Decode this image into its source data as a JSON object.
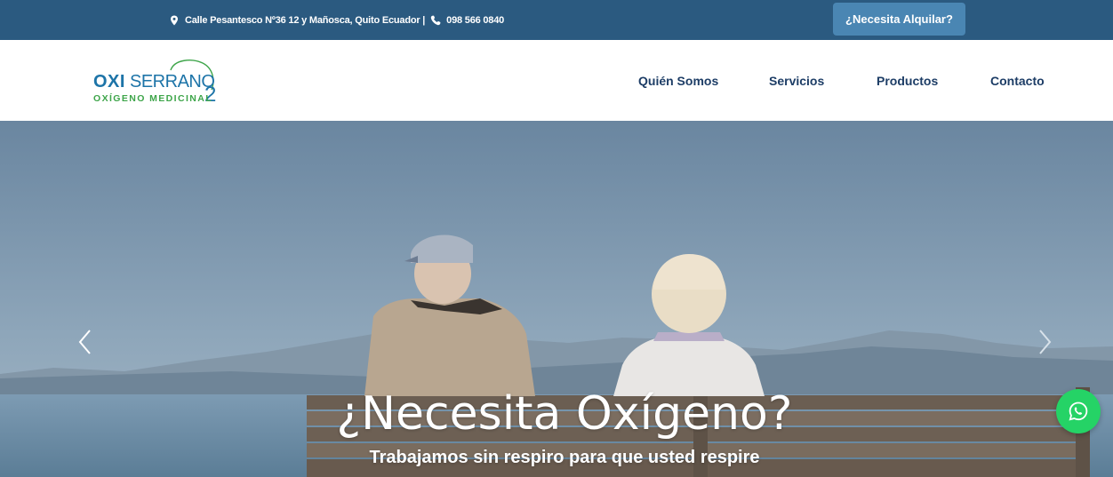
{
  "topbar": {
    "address": "Calle Pesantesco Nº36 12 y Mañosca, Quito   Ecuador |",
    "phone": "098 566 0840",
    "rent_button": "¿Necesita Alquilar?"
  },
  "logo": {
    "oxi": "OXI",
    "serrano": "SERRANO",
    "subtitle": "OXÍGENO MEDICINAL",
    "subscript": "2"
  },
  "nav": {
    "items": [
      "Quién Somos",
      "Servicios",
      "Productos",
      "Contacto"
    ]
  },
  "hero": {
    "title": "¿Necesita Oxígeno?",
    "subtitle": "Trabajamos sin respiro para que usted respire"
  },
  "icons": {
    "location": "map-pin-icon",
    "phone": "phone-icon",
    "prev": "chevron-left-icon",
    "next": "chevron-right-icon",
    "whatsapp": "whatsapp-icon"
  },
  "colors": {
    "topbar": "#2b5a80",
    "rent_button": "#4a86b3",
    "nav_text": "#1d3d66",
    "logo_blue": "#1d74a8",
    "logo_green": "#3ea54a",
    "whatsapp": "#25d366"
  }
}
